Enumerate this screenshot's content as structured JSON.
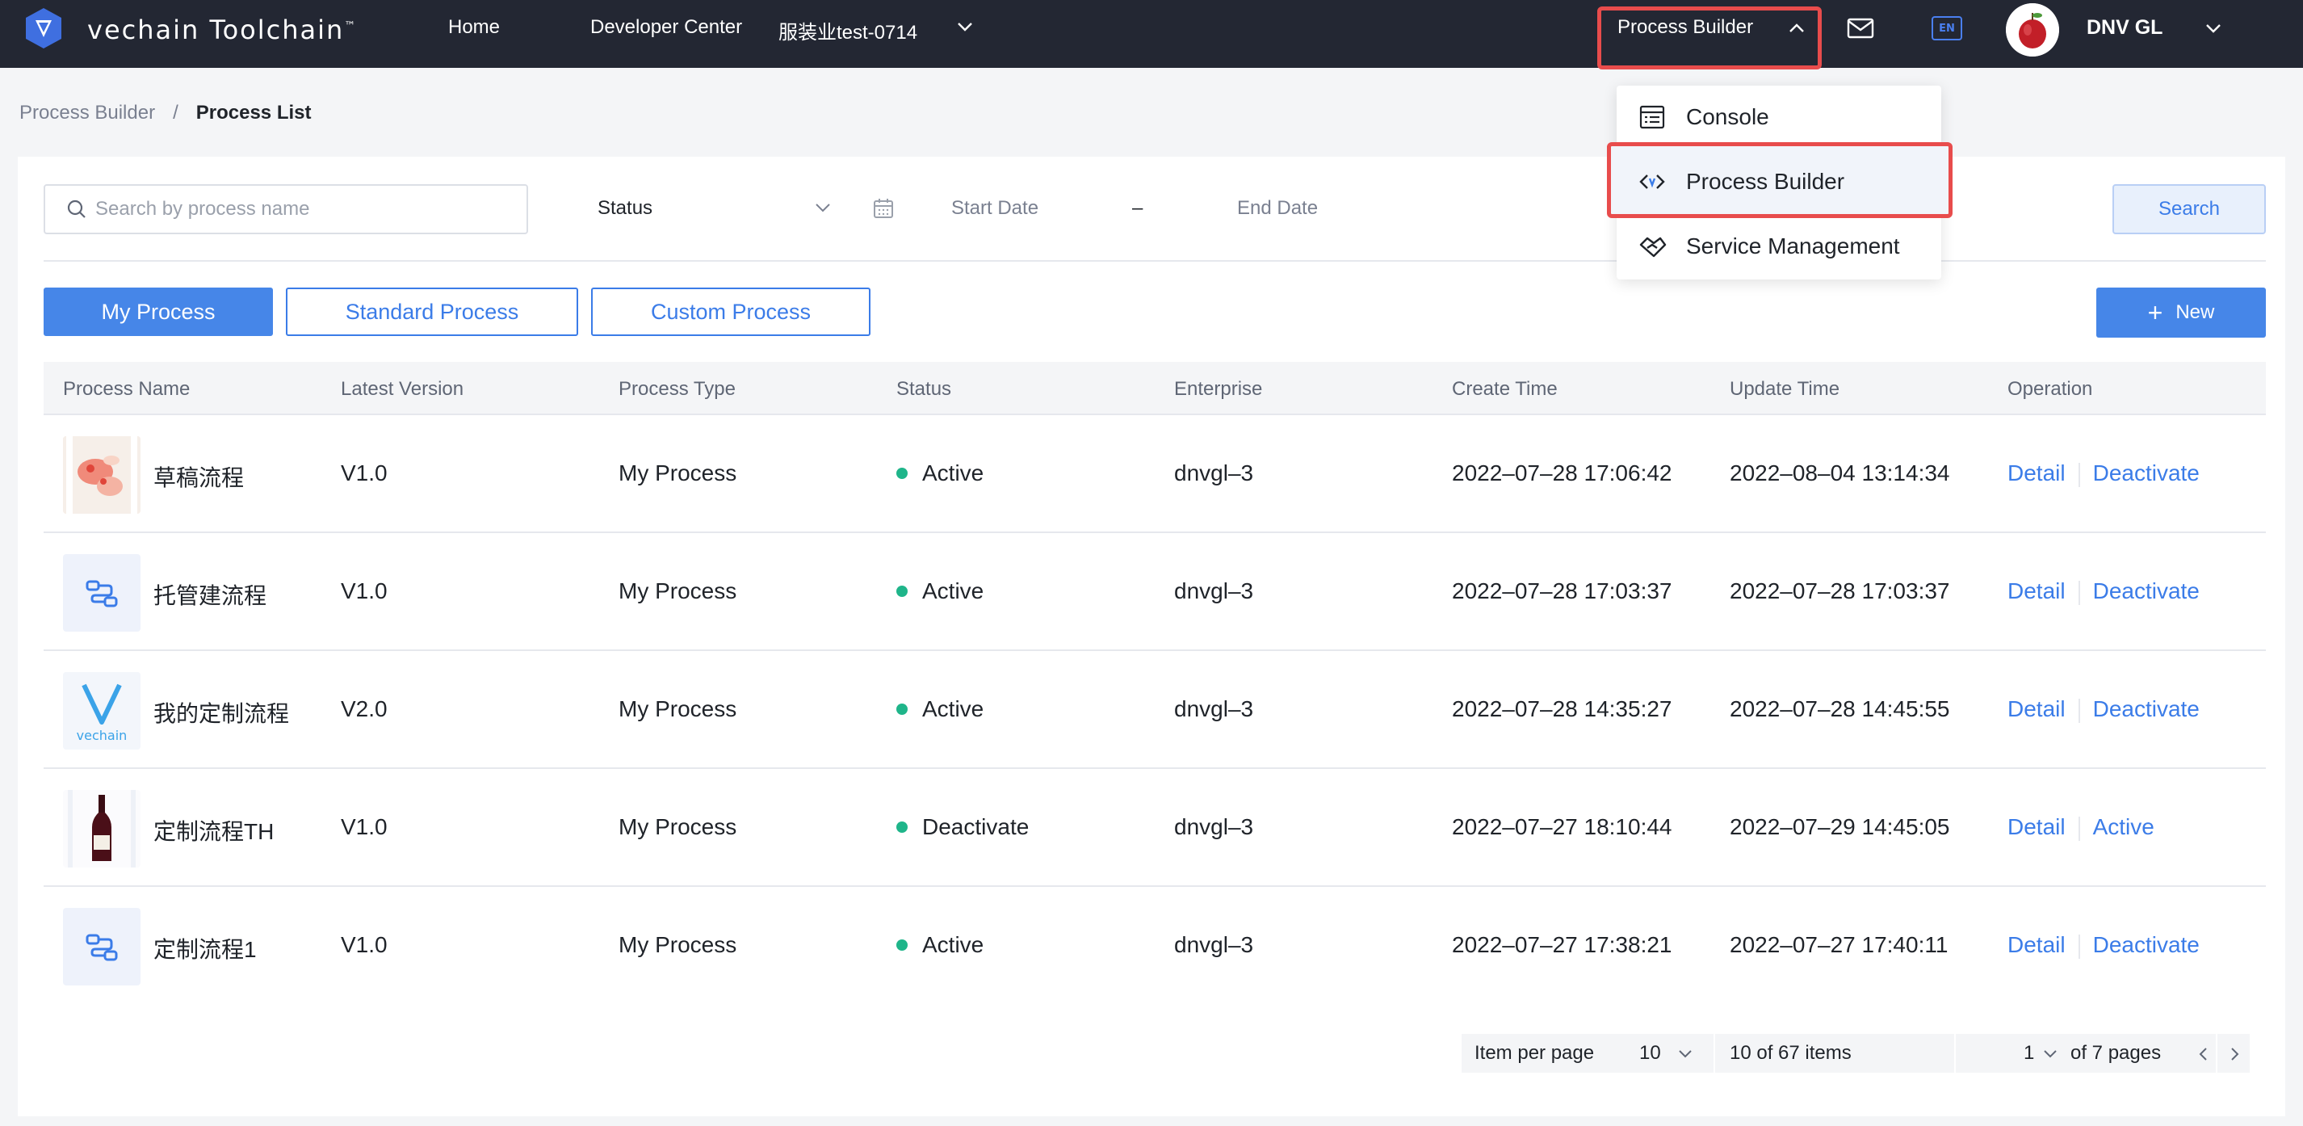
{
  "topbar": {
    "brand": "vechain Toolchain",
    "brand_tm": "™",
    "home": "Home",
    "developer_center": "Developer Center",
    "organization": "服装业test-0714",
    "process_builder_menu": "Process Builder",
    "language_badge": "EN",
    "user_name": "DNV GL"
  },
  "dropdown": {
    "items": [
      {
        "label": "Console",
        "icon": "console-icon"
      },
      {
        "label": "Process Builder",
        "icon": "process-builder-icon"
      },
      {
        "label": "Service Management",
        "icon": "service-management-icon"
      }
    ]
  },
  "breadcrumb": {
    "parent": "Process Builder",
    "separator": "/",
    "current": "Process List"
  },
  "filters": {
    "search_placeholder": "Search by process name",
    "status_label": "Status",
    "start_date": "Start Date",
    "date_separator": "–",
    "end_date": "End Date",
    "search_button": "Search"
  },
  "tabs": {
    "my_process": "My Process",
    "standard_process": "Standard Process",
    "custom_process": "Custom Process",
    "new_button": "New",
    "new_plus": "+"
  },
  "table": {
    "headers": [
      "Process Name",
      "Latest Version",
      "Process Type",
      "Status",
      "Enterprise",
      "Create Time",
      "Update Time",
      "Operation"
    ],
    "rows": [
      {
        "name": "草稿流程",
        "version": "V1.0",
        "type": "My Process",
        "status": "Active",
        "enterprise": "dnvgl–3",
        "create": "2022–07–28 17:06:42",
        "update": "2022–08–04 13:14:34",
        "op1": "Detail",
        "op2": "Deactivate",
        "thumb": "photo"
      },
      {
        "name": "托管建流程",
        "version": "V1.0",
        "type": "My Process",
        "status": "Active",
        "enterprise": "dnvgl–3",
        "create": "2022–07–28 17:03:37",
        "update": "2022–07–28 17:03:37",
        "op1": "Detail",
        "op2": "Deactivate",
        "thumb": "flow"
      },
      {
        "name": "我的定制流程",
        "version": "V2.0",
        "type": "My Process",
        "status": "Active",
        "enterprise": "dnvgl–3",
        "create": "2022–07–28 14:35:27",
        "update": "2022–07–28 14:45:55",
        "op1": "Detail",
        "op2": "Deactivate",
        "thumb": "vechain"
      },
      {
        "name": "定制流程TH",
        "version": "V1.0",
        "type": "My Process",
        "status": "Deactivate",
        "enterprise": "dnvgl–3",
        "create": "2022–07–27 18:10:44",
        "update": "2022–07–29 14:45:05",
        "op1": "Detail",
        "op2": "Active",
        "thumb": "wine"
      },
      {
        "name": "定制流程1",
        "version": "V1.0",
        "type": "My Process",
        "status": "Active",
        "enterprise": "dnvgl–3",
        "create": "2022–07–27 17:38:21",
        "update": "2022–07–27 17:40:11",
        "op1": "Detail",
        "op2": "Deactivate",
        "thumb": "flow"
      }
    ],
    "thumb_vechain_text": "vechain"
  },
  "pagination": {
    "per_page_label": "Item per page",
    "per_page_value": "10",
    "items_summary": "10 of 67 items",
    "current_page": "1",
    "of_pages": "of 7 pages"
  },
  "colors": {
    "navbar": "#232733",
    "accent": "#3b7ce8",
    "highlight_border": "#e84c4c",
    "status_dot": "#1fb58a"
  }
}
